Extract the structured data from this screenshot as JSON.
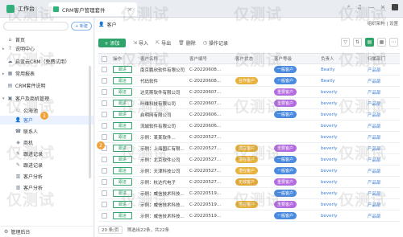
{
  "titlebar": {
    "app": "工作台",
    "tab": "CRM客户管理套件"
  },
  "sidebar": {
    "new_label": "+ 新建",
    "items": [
      {
        "label": "首页",
        "icon": "home-icon",
        "caret": ""
      },
      {
        "label": "说明中心",
        "icon": "help-icon",
        "caret": "▸"
      },
      {
        "label": "启蓝云CRM（免费试用）",
        "icon": "cloud-icon",
        "caret": ""
      },
      {
        "label": "常用报表",
        "icon": "report-icon",
        "caret": "▸"
      },
      {
        "label": "CRM套件说明",
        "icon": "doc-icon",
        "caret": ""
      },
      {
        "label": "客户及商机管理",
        "icon": "folder-icon",
        "caret": "▾"
      },
      {
        "label": "公海池",
        "icon": "users-icon",
        "caret": ""
      },
      {
        "label": "客户",
        "icon": "user-icon",
        "caret": ""
      },
      {
        "label": "联系人",
        "icon": "contact-icon",
        "caret": ""
      },
      {
        "label": "商机",
        "icon": "opportunity-icon",
        "caret": ""
      },
      {
        "label": "跟进记录",
        "icon": "record-icon",
        "caret": ""
      },
      {
        "label": "跟进记录",
        "icon": "record-icon",
        "caret": ""
      },
      {
        "label": "客户分析",
        "icon": "chart-icon",
        "caret": ""
      },
      {
        "label": "客户分析",
        "icon": "chart-icon",
        "caret": ""
      }
    ],
    "footer": "管理后台",
    "badge": "1"
  },
  "main": {
    "breadcrumb": "客户",
    "top_right": "组织架构 | 设置",
    "toolbar": {
      "add": "+ 添加",
      "import": "导入",
      "export": "导出",
      "delete": "删除",
      "log": "操作记录"
    },
    "columns": [
      "操作",
      "客户名称",
      "客户编号",
      "客户状态",
      "客户等级",
      "负责人",
      "归属部门"
    ],
    "rows": [
      {
        "op": "跟进",
        "name": "南京鹏欣软件有限公司",
        "num": "C-20220608...",
        "status": "",
        "status_color": "",
        "level": "一般客户",
        "level_color": "#4a8be0",
        "owner": "Beatly",
        "dept": "产品部"
      },
      {
        "op": "跟进",
        "name": "代码软件",
        "num": "C-20220608...",
        "status": "合作客户",
        "status_color": "#e7b23d",
        "level": "一般客户",
        "level_color": "#4a8be0",
        "owner": "Beatly",
        "dept": "产品部"
      },
      {
        "op": "跟进",
        "name": "达克斯软件有限公司",
        "num": "C-20220607...",
        "status": "",
        "status_color": "",
        "level": "重要客户",
        "level_color": "#b46ae0",
        "owner": "beverly",
        "dept": "产品部"
      },
      {
        "op": "跟进",
        "name": "叶维科技有限公司",
        "num": "C-20220607...",
        "status": "",
        "status_color": "",
        "level": "重要客户",
        "level_color": "#b46ae0",
        "owner": "beverly",
        "dept": "产品部"
      },
      {
        "op": "跟进",
        "name": "启明网有限公司",
        "num": "C-20220606...",
        "status": "",
        "status_color": "",
        "level": "一般客户",
        "level_color": "#4a8be0",
        "owner": "beverly",
        "dept": "产品部"
      },
      {
        "op": "跟进",
        "name": "流城软件有限公司",
        "num": "C-20220606...",
        "status": "",
        "status_color": "",
        "level": "",
        "level_color": "",
        "owner": "beverly",
        "dept": "产品部"
      },
      {
        "op": "跟进",
        "name": "示例：某某软件...",
        "num": "C-20220527...",
        "status": "",
        "status_color": "",
        "level": "",
        "level_color": "",
        "owner": "beverly",
        "dept": "产品部"
      },
      {
        "op": "跟进",
        "name": "示例：上海国汇有限...",
        "num": "C-20220527...",
        "status": "潜在客户",
        "status_color": "#e7b23d",
        "level": "重要客户",
        "level_color": "#b46ae0",
        "owner": "beverly",
        "dept": "产品部"
      },
      {
        "op": "跟进",
        "name": "示例：北京软件公司",
        "num": "C-20220527...",
        "status": "潜在客户",
        "status_color": "#e7b23d",
        "level": "一般客户",
        "level_color": "#4a8be0",
        "owner": "beverly",
        "dept": "产品部"
      },
      {
        "op": "跟进",
        "name": "示例：天津科技公司",
        "num": "C-20220527...",
        "status": "潜在客户",
        "status_color": "#e7b23d",
        "level": "一般客户",
        "level_color": "#4a8be0",
        "owner": "beverly",
        "dept": "产品部"
      },
      {
        "op": "跟进",
        "name": "示例：杭达代电子",
        "num": "C-20220527...",
        "status": "无效客户",
        "status_color": "#e0a83a",
        "level": "重要客户",
        "level_color": "#b46ae0",
        "owner": "beverly",
        "dept": "产品部"
      },
      {
        "op": "跟进",
        "name": "示例：威信技术科技...",
        "num": "C-20220519...",
        "status": "",
        "status_color": "",
        "level": "一般客户",
        "level_color": "#4a8be0",
        "owner": "beverly",
        "dept": "产品部"
      },
      {
        "op": "跟进",
        "name": "示例：威信技术科技...",
        "num": "C-20220519...",
        "status": "潜在客户",
        "status_color": "#e7b23d",
        "level": "重要客户",
        "level_color": "#b46ae0",
        "owner": "beverly",
        "dept": "产品部"
      },
      {
        "op": "跟进",
        "name": "示例：威信技术科技...",
        "num": "C-20220519...",
        "status": "",
        "status_color": "",
        "level": "一般客户",
        "level_color": "#4a8be0",
        "owner": "beverly",
        "dept": "产品部"
      }
    ],
    "badge": "2",
    "pager": {
      "size": "20 条/页",
      "summary": "筛选出22条，共22条"
    }
  },
  "watermark": "仅测试"
}
